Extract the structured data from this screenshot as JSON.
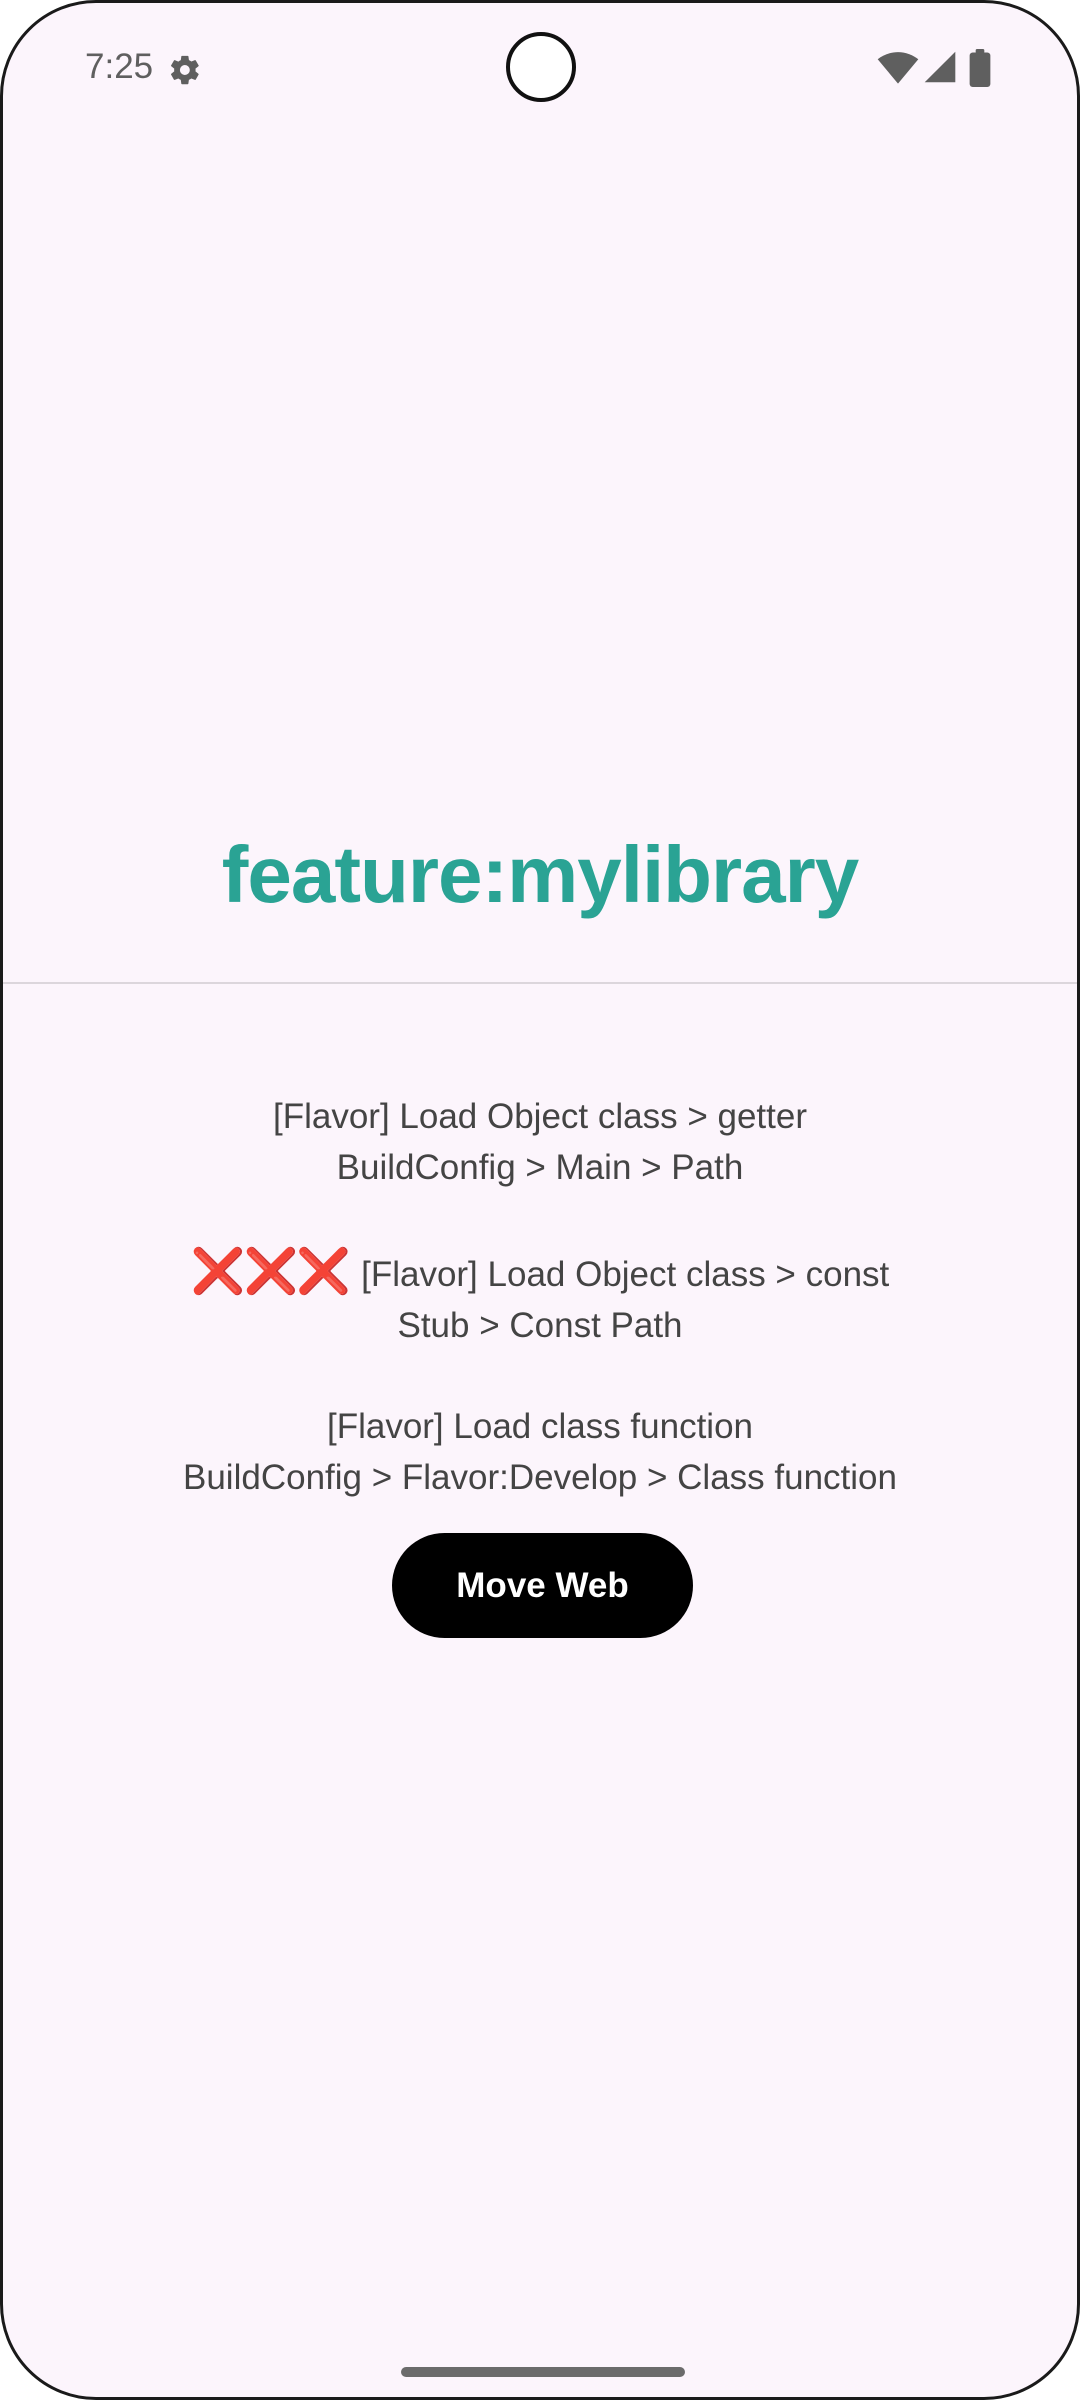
{
  "status_bar": {
    "time": "7:25",
    "left_icon": "settings-gear-icon",
    "right_icons": [
      "wifi-icon",
      "cell-signal-icon",
      "battery-icon"
    ]
  },
  "screen": {
    "title": "feature:mylibrary",
    "messages": [
      {
        "line1": "[Flavor] Load Object class > getter",
        "line2": "BuildConfig > Main > Path"
      },
      {
        "prefix": "❌❌❌",
        "line1": "[Flavor] Load Object class > const",
        "line2": "Stub > Const Path"
      },
      {
        "line1": "[Flavor] Load class function",
        "line2": "BuildConfig > Flavor:Develop > Class function"
      }
    ],
    "button_label": "Move Web"
  },
  "colors": {
    "background": "#fcf5fc",
    "title": "#2aa394",
    "body_text": "#444444",
    "button_bg": "#000000",
    "button_text": "#ffffff",
    "error_mark": "#e53935"
  }
}
